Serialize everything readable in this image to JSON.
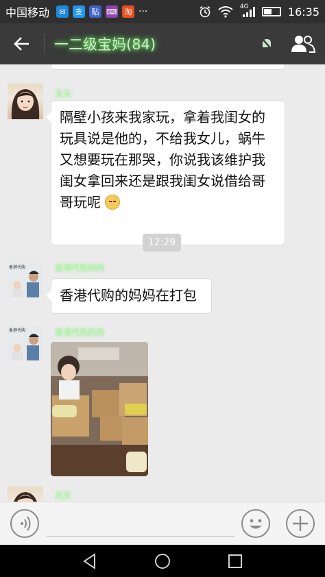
{
  "status_bar": {
    "carrier": "中国移动",
    "apps": [
      {
        "name": "weixin-app-icon",
        "glyph": "✉",
        "color": "#1e88d9"
      },
      {
        "name": "alipay-app-icon",
        "glyph": "支",
        "color": "#2196f3"
      },
      {
        "name": "tieba-app-icon",
        "glyph": "贴",
        "color": "#3f63c9"
      },
      {
        "name": "keyboard-app-icon",
        "glyph": "⌨",
        "color": "#8e44ad"
      },
      {
        "name": "taobao-app-icon",
        "glyph": "淘",
        "color": "#e8501f"
      }
    ],
    "more": "···",
    "network": "4G",
    "time": "16:35"
  },
  "header": {
    "title": "一二级宝妈(84)"
  },
  "messages": [
    {
      "sender": "天天",
      "text": "隔壁小孩来我家玩，拿着我闺女的玩具说是他的，不给我女儿，蜗牛又想要玩在那哭，你说我该维护我闺女拿回来还是跟我闺女说借给哥哥玩呢"
    },
    {
      "time": "12:29"
    },
    {
      "sender": "香港代购妈妈",
      "text": "香港代购的妈妈在打包"
    },
    {
      "sender": "香港代购妈妈",
      "image": "photo"
    },
    {
      "sender": "天天"
    }
  ],
  "avatar_labels": {
    "store": "香港代购"
  },
  "input": {
    "placeholder": ""
  },
  "colors": {
    "status_bar": "#2f2f2f",
    "title_bar": "#3a3a3a",
    "chat_bg": "#ebebeb",
    "bubble": "#ffffff",
    "highlight_green": "#7cff6a"
  }
}
